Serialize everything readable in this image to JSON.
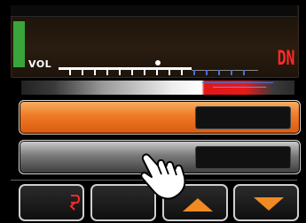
{
  "display": {
    "vol_label": "VOL",
    "direction_label": "DN",
    "meter_color": "#38a63a",
    "level_percent": 60
  },
  "buttons": [
    {
      "name": "primary",
      "color": "#ef7a25",
      "slot_text": ""
    },
    {
      "name": "secondary",
      "color": "#7a7a7a",
      "slot_text": ""
    }
  ],
  "softkeys": [
    {
      "icon": "return-icon",
      "label": ""
    },
    {
      "icon": "",
      "label": ""
    },
    {
      "icon": "triangle-up-icon",
      "label": ""
    },
    {
      "icon": "triangle-down-icon",
      "label": ""
    }
  ],
  "colors": {
    "accent": "#f08a22",
    "alert": "#ff2a2a"
  }
}
